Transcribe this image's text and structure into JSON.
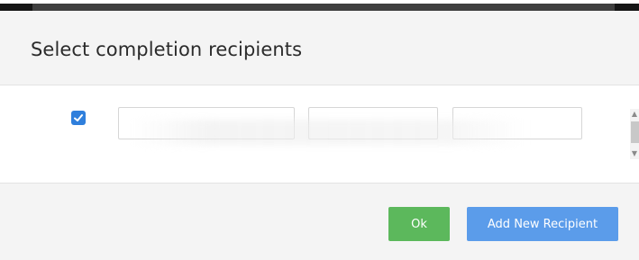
{
  "dialog": {
    "title": "Select completion recipients"
  },
  "recipient_row": {
    "checked": true,
    "fields": [
      {
        "value": ""
      },
      {
        "value": ""
      },
      {
        "value": ""
      }
    ]
  },
  "footer": {
    "ok_label": "Ok",
    "add_label": "Add New Recipient"
  },
  "colors": {
    "ok_button": "#5cb85c",
    "add_button": "#5b9cea",
    "checkbox": "#2f7fdc",
    "header_bg": "#f4f4f4"
  },
  "icons": {
    "checkbox": "checkmark-icon",
    "scroll_up": "chevron-up-icon",
    "scroll_down": "chevron-down-icon"
  }
}
